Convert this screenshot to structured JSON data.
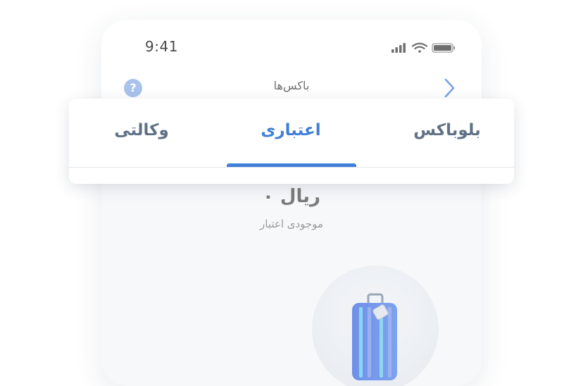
{
  "status_bar": {
    "time": "9:41",
    "icons": [
      "cellular-signal-icon",
      "wifi-icon",
      "battery-icon"
    ]
  },
  "header": {
    "title": "باکس‌ها",
    "help_label": "?",
    "back_icon": "chevron-right-icon"
  },
  "tabs": [
    {
      "label": "بلوباکس",
      "active": false
    },
    {
      "label": "اعتباری",
      "active": true
    },
    {
      "label": "وکالتی",
      "active": false
    }
  ],
  "balance": {
    "amount": "۰ ریال",
    "label": "موجودی اعتبار"
  },
  "illustration": {
    "icon": "suitcase-icon"
  },
  "colors": {
    "accent": "#3f7fd8",
    "tab_inactive": "#5f7186",
    "help_badge": "#a9c3ec",
    "background": "#f7f8fa"
  }
}
